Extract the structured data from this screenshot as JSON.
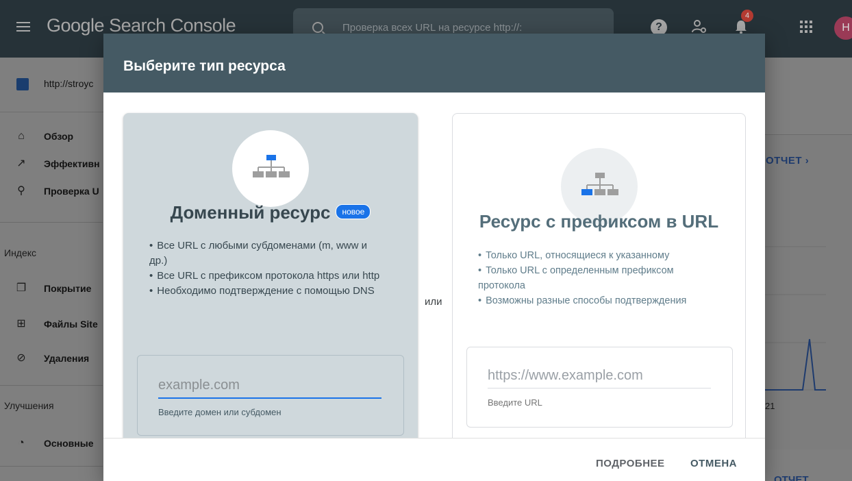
{
  "app": {
    "logo_text": "Google Search Console",
    "search_placeholder": "Проверка всех URL на ресурсе http://:",
    "notification_count": "4",
    "avatar_letter": "Н",
    "help_glyph": "?"
  },
  "sidebar": {
    "property": "http://stroyc",
    "items_top": [
      {
        "label": "Обзор",
        "icon": "home-icon"
      },
      {
        "label": "Эффективн",
        "icon": "trending-icon"
      },
      {
        "label": "Проверка U",
        "icon": "search-icon"
      }
    ],
    "section_index": "Индекс",
    "items_index": [
      {
        "label": "Покрытие",
        "icon": "copy-icon"
      },
      {
        "label": "Файлы Site",
        "icon": "sitemap-icon"
      },
      {
        "label": "Удаления",
        "icon": "eye-off-icon"
      }
    ],
    "section_enhancements": "Улучшения",
    "items_enh": [
      {
        "label": "Основные",
        "icon": "gauge-icon"
      }
    ]
  },
  "background": {
    "report_link": "ОТЧЕТ",
    "report_link2": "ОТЧЕТ",
    "tick_label": "21"
  },
  "modal": {
    "title": "Выберите тип ресурса",
    "or_label": "или",
    "domain": {
      "title": "Доменный ресурс",
      "badge": "новое",
      "bullets": [
        "Все URL с любыми субдоменами (m, www и др.)",
        "Все URL с префиксом протокола https или http",
        "Необходимо подтверждение с помощью DNS"
      ],
      "input_placeholder": "example.com",
      "input_help": "Введите домен или субдомен"
    },
    "url_prefix": {
      "title": "Ресурс с префиксом в URL",
      "bullets": [
        "Только URL, относящиеся к указанному",
        "Только URL с определенным префиксом протокола",
        "Возможны разные способы подтверждения"
      ],
      "input_placeholder": "https://www.example.com",
      "input_help": "Введите URL"
    },
    "footer": {
      "more_label": "ПОДРОБНЕЕ",
      "cancel_label": "ОТМЕНА"
    }
  },
  "colors": {
    "header": "#455a64",
    "topbar": "#263238",
    "accent": "#1a73e8",
    "domain_card": "#cfd8dc"
  }
}
